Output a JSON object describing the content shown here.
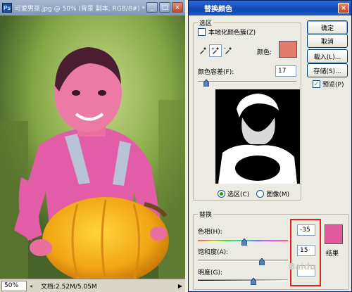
{
  "document": {
    "title": "可爱男孩.jpg @ 50% (背景 副本, RGB/8#) *",
    "ps_icon": "Ps",
    "window_buttons": {
      "minimize": "_",
      "maximize": "□",
      "close": "×"
    },
    "status": {
      "zoom": "50%",
      "doc_info": "文档:2.52M/5.05M",
      "arrow": "▶"
    }
  },
  "dialog": {
    "title": "替换颜色",
    "close": "×",
    "selection": {
      "group_label": "选区",
      "localized_clusters_label": "本地化颜色簇(Z)",
      "localized_clusters_checked": false,
      "color_label": "颜色:",
      "color_value": "#e27c6c",
      "fuzziness_label": "颜色容差(F):",
      "fuzziness_value": "17",
      "fuzziness_level": 0.085,
      "selection_radio_label": "选区(C)",
      "image_radio_label": "图像(M)",
      "selected_view": "selection"
    },
    "replacement": {
      "group_label": "替换",
      "hue_label": "色相(H):",
      "hue_value": "-35",
      "saturation_label": "饱和度(A):",
      "saturation_value": "15",
      "lightness_label": "明度(G):",
      "lightness_value": "",
      "result_label": "结果",
      "result_color": "#e05a9c"
    },
    "buttons": {
      "ok": "确定",
      "cancel": "取消",
      "load": "载入(L)...",
      "save": "存储(S)...",
      "preview": "预览(P)",
      "preview_checked": true
    },
    "watermark": "Baidu"
  },
  "colors": {
    "accent_blue": "#0d47b6",
    "highlight_red": "#e0231b"
  }
}
